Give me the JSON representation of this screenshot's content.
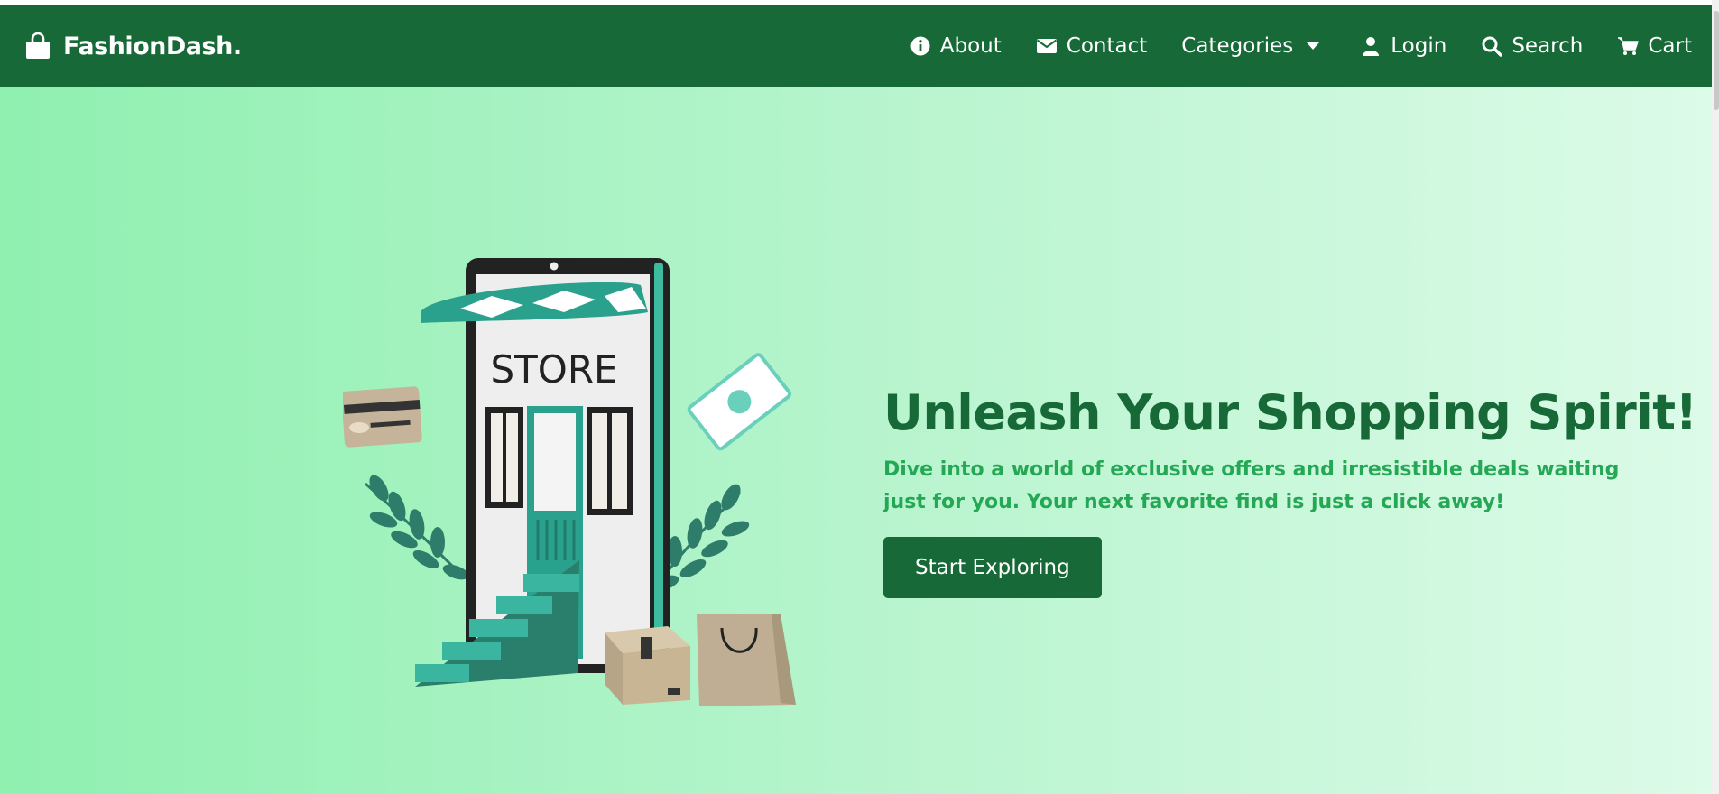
{
  "brand": {
    "name": "FashionDash.",
    "icon": "shopping-bag-icon"
  },
  "nav": {
    "items": [
      {
        "label": "About",
        "icon": "info-circle-icon"
      },
      {
        "label": "Contact",
        "icon": "envelope-icon"
      },
      {
        "label": "Categories",
        "icon": "caret-down-icon"
      },
      {
        "label": "Login",
        "icon": "user-icon"
      },
      {
        "label": "Search",
        "icon": "search-icon"
      },
      {
        "label": "Cart",
        "icon": "cart-icon"
      }
    ]
  },
  "hero": {
    "title": "Unleash Your Shopping Spirit!",
    "subtitle": "Dive into a world of exclusive offers and irresistible deals waiting just for you. Your next favorite find is just a click away!",
    "cta_label": "Start Exploring",
    "illustration": {
      "sign_text": "STORE"
    }
  },
  "colors": {
    "navbar": "#176937",
    "title": "#176937",
    "subtitle": "#25a855",
    "button": "#176937",
    "hero_gradient_start": "#8ff0b0",
    "hero_gradient_end": "#dcfbe8"
  }
}
